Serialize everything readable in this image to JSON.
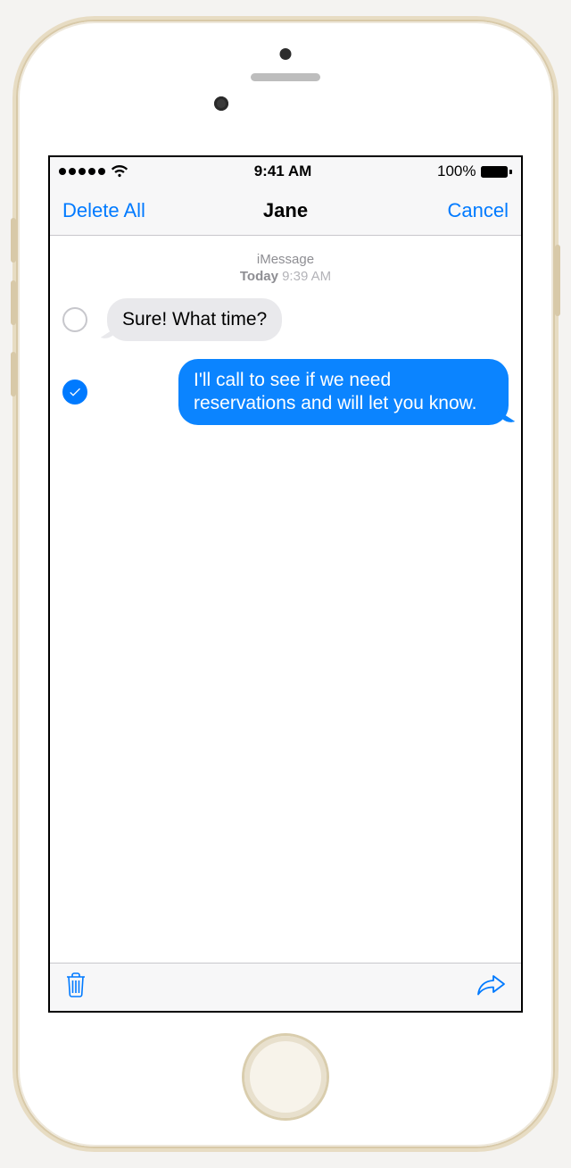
{
  "statusBar": {
    "time": "9:41 AM",
    "batteryText": "100%"
  },
  "navBar": {
    "leftLabel": "Delete All",
    "title": "Jane",
    "rightLabel": "Cancel"
  },
  "thread": {
    "stampService": "iMessage",
    "stampDayWord": "Today",
    "stampTime": "9:39 AM",
    "messages": [
      {
        "direction": "incoming",
        "selected": false,
        "text": "Sure! What time?"
      },
      {
        "direction": "outgoing",
        "selected": true,
        "text": "I'll call to see if we need reservations and will let you know."
      }
    ]
  }
}
